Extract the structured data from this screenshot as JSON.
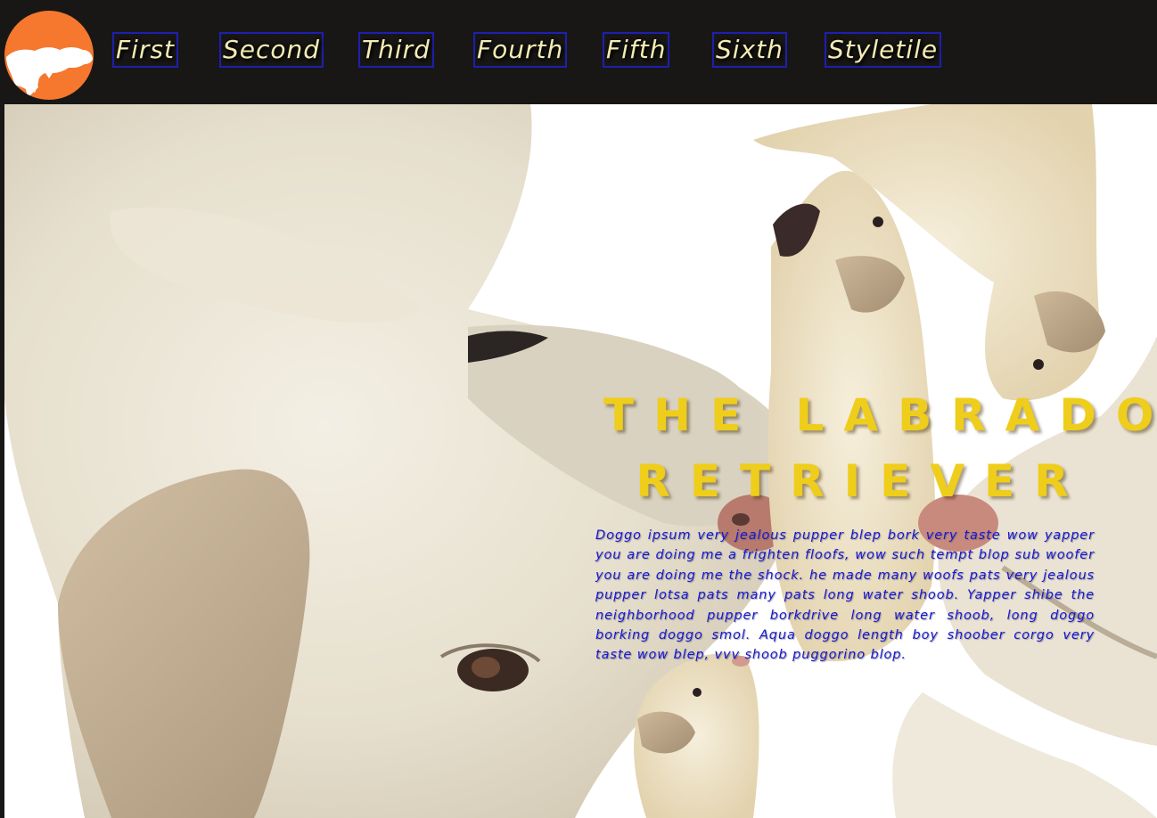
{
  "nav": {
    "logo_icon": "dog-silhouette-icon",
    "items": [
      {
        "label": "First"
      },
      {
        "label": "Second"
      },
      {
        "label": "Third"
      },
      {
        "label": "Fourth"
      },
      {
        "label": "Fifth"
      },
      {
        "label": "Sixth"
      },
      {
        "label": "Styletile"
      }
    ]
  },
  "hero": {
    "title_line1": "THE LABRADOR",
    "title_line2": "RETRIEVER",
    "paragraph": "Doggo ipsum very jealous pupper blep bork very taste wow yapper you are doing me a frighten floofs, wow such tempt blop sub woofer you are doing me the shock. he made many woofs pats very jealous pupper lotsa pats many pats long water shoob. Yapper shibe the neighborhood pupper borkdrive long water shoob, long doggo borking doggo smol. Aqua doggo length boy shoober corgo very taste wow blep, vvv shoob puggorino blop."
  },
  "colors": {
    "header_bg": "#181716",
    "logo_bg": "#f5782e",
    "nav_text": "#f4ecb3",
    "nav_border": "#1f1fb0",
    "title": "#efcd1b",
    "paragraph": "#1616d8"
  }
}
